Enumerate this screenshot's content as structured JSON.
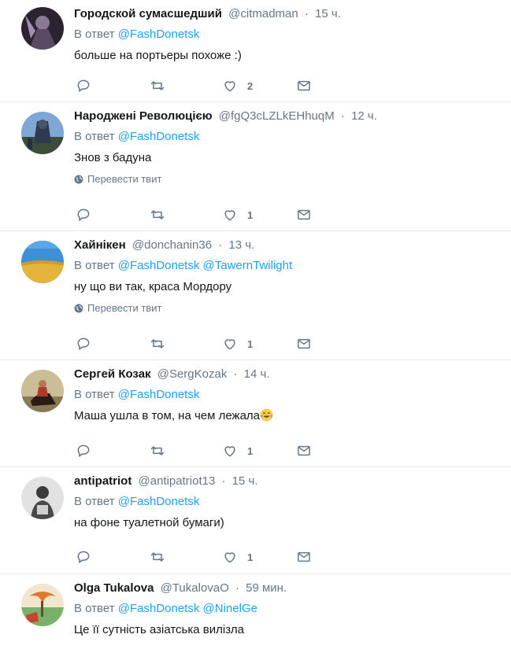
{
  "tweets": [
    {
      "fullname": "Городской сумасшедший",
      "username": "@citmadman",
      "sep": "·",
      "time": "15 ч.",
      "reply_prefix": "В ответ",
      "mentions": [
        "@FashDonetsk"
      ],
      "text": "больше на портьеры похоже :)",
      "translate": "",
      "likes": "2",
      "avatar_colors": [
        "#3a2f3a",
        "#7a6a8a"
      ]
    },
    {
      "fullname": "Народжені Революцією",
      "username": "@fgQ3cLZLkEHhuqM",
      "sep": "·",
      "time": "12 ч.",
      "reply_prefix": "В ответ",
      "mentions": [
        "@FashDonetsk"
      ],
      "text": "Знов з бадуна",
      "translate": "Перевести твит",
      "likes": "1",
      "avatar_colors": [
        "#5f86b8",
        "#2d3d52"
      ]
    },
    {
      "fullname": "Хайнікен",
      "username": "@donchanin36",
      "sep": "·",
      "time": "13 ч.",
      "reply_prefix": "В ответ",
      "mentions": [
        "@FashDonetsk",
        "@TawernTwilight"
      ],
      "text": "ну що ви так, краса Мордору",
      "translate": "Перевести твит",
      "likes": "1",
      "avatar_colors": [
        "#3b8fd6",
        "#e0b43a"
      ]
    },
    {
      "fullname": "Сергей Козак",
      "username": "@SergKozak",
      "sep": "·",
      "time": "14 ч.",
      "reply_prefix": "В ответ",
      "mentions": [
        "@FashDonetsk"
      ],
      "text": "Маша ушла в том, на чем лежала",
      "translate": "",
      "likes": "1",
      "avatar_colors": [
        "#c9b98f",
        "#6a4b2f"
      ]
    },
    {
      "fullname": "antipatriot",
      "username": "@antipatriot13",
      "sep": "·",
      "time": "15 ч.",
      "reply_prefix": "В ответ",
      "mentions": [
        "@FashDonetsk"
      ],
      "text": "на фоне туалетной бумаги)",
      "translate": "",
      "likes": "1",
      "avatar_colors": [
        "#d8d8d8",
        "#3c3c3c"
      ]
    },
    {
      "fullname": "Olga Tukalova",
      "username": "@TukalovaO",
      "sep": "·",
      "time": "59 мин.",
      "reply_prefix": "В ответ",
      "mentions": [
        "@FashDonetsk",
        "@NinelGe"
      ],
      "text": "Це її сутність азіатська вилізла",
      "translate": "",
      "likes": "",
      "avatar_colors": [
        "#e6a05a",
        "#6aa86a"
      ]
    }
  ],
  "colors": {
    "accent": "#1da1f2",
    "muted": "#657786",
    "divider": "#e6ecf0"
  },
  "icons": [
    "reply-icon",
    "retweet-icon",
    "like-icon",
    "message-icon",
    "globe-icon"
  ]
}
